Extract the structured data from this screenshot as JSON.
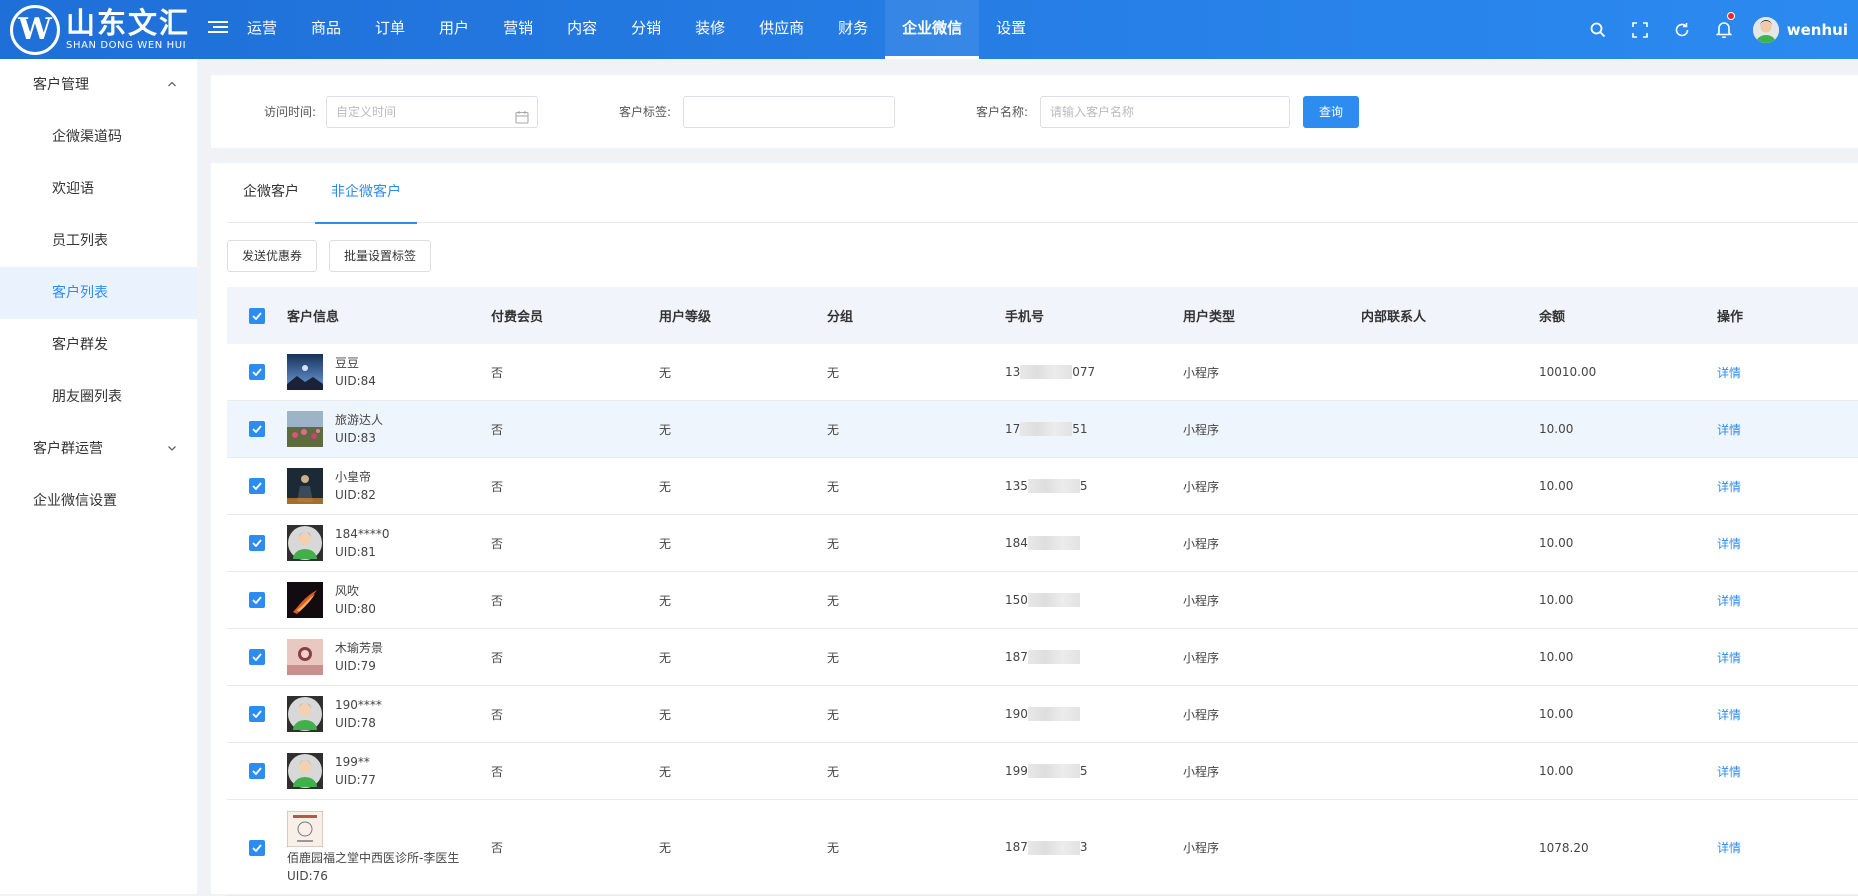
{
  "brand": {
    "name_cn": "山东文汇",
    "name_en": "SHAN DONG WEN HUI",
    "logo_letter": "W"
  },
  "nav": {
    "items": [
      "运营",
      "商品",
      "订单",
      "用户",
      "营销",
      "内容",
      "分销",
      "装修",
      "供应商",
      "财务",
      "企业微信",
      "设置"
    ],
    "active": "企业微信"
  },
  "user": {
    "name": "wenhui"
  },
  "sidebar": {
    "groups": [
      {
        "label": "客户管理",
        "expanded": true,
        "items": [
          "企微渠道码",
          "欢迎语",
          "员工列表",
          "客户列表",
          "客户群发",
          "朋友圈列表"
        ],
        "active": "客户列表"
      },
      {
        "label": "客户群运营",
        "expanded": false
      },
      {
        "label": "企业微信设置"
      }
    ]
  },
  "filters": {
    "visit_time_label": "访问时间:",
    "visit_time_placeholder": "自定义时间",
    "tag_label": "客户标签:",
    "tag_value": "",
    "name_label": "客户名称:",
    "name_placeholder": "请输入客户名称",
    "query_label": "查询"
  },
  "tabs": {
    "items": [
      "企微客户",
      "非企微客户"
    ],
    "active": "非企微客户"
  },
  "actions": {
    "send_coupon": "发送优惠券",
    "batch_tag": "批量设置标签"
  },
  "table": {
    "columns": [
      "客户信息",
      "付费会员",
      "用户等级",
      "分组",
      "手机号",
      "用户类型",
      "内部联系人",
      "余额",
      "操作"
    ],
    "rows": [
      {
        "name": "豆豆",
        "uid": "UID:84",
        "vip": "否",
        "level": "无",
        "group": "无",
        "phone_prefix": "13",
        "phone_suffix": "077",
        "type": "小程序",
        "contact": "",
        "balance": "10010.00",
        "op": "详情",
        "avatar": "night-sky"
      },
      {
        "name": "旅游达人",
        "uid": "UID:83",
        "vip": "否",
        "level": "无",
        "group": "无",
        "phone_prefix": "17",
        "phone_suffix": "51",
        "type": "小程序",
        "contact": "",
        "balance": "10.00",
        "op": "详情",
        "avatar": "flowers"
      },
      {
        "name": "小皇帝",
        "uid": "UID:82",
        "vip": "否",
        "level": "无",
        "group": "无",
        "phone_prefix": "135",
        "phone_suffix": "5",
        "type": "小程序",
        "contact": "",
        "balance": "10.00",
        "op": "详情",
        "avatar": "dark-figure"
      },
      {
        "name": "184****0",
        "uid": "UID:81",
        "vip": "否",
        "level": "无",
        "group": "无",
        "phone_prefix": "184",
        "phone_suffix": "",
        "type": "小程序",
        "contact": "",
        "balance": "10.00",
        "op": "详情",
        "avatar": "default"
      },
      {
        "name": "风吹",
        "uid": "UID:80",
        "vip": "否",
        "level": "无",
        "group": "无",
        "phone_prefix": "150",
        "phone_suffix": "",
        "type": "小程序",
        "contact": "",
        "balance": "10.00",
        "op": "详情",
        "avatar": "flame"
      },
      {
        "name": "木瑜芳景",
        "uid": "UID:79",
        "vip": "否",
        "level": "无",
        "group": "无",
        "phone_prefix": "187",
        "phone_suffix": "",
        "type": "小程序",
        "contact": "",
        "balance": "10.00",
        "op": "详情",
        "avatar": "pink"
      },
      {
        "name": "190****",
        "uid": "UID:78",
        "vip": "否",
        "level": "无",
        "group": "无",
        "phone_prefix": "190",
        "phone_suffix": "",
        "type": "小程序",
        "contact": "",
        "balance": "10.00",
        "op": "详情",
        "avatar": "default"
      },
      {
        "name": "199**",
        "uid": "UID:77",
        "vip": "否",
        "level": "无",
        "group": "无",
        "phone_prefix": "199",
        "phone_suffix": "5",
        "type": "小程序",
        "contact": "",
        "balance": "10.00",
        "op": "详情",
        "avatar": "default"
      },
      {
        "name": "佰鹿园福之堂中西医诊所-李医生",
        "uid": "UID:76",
        "vip": "否",
        "level": "无",
        "group": "无",
        "phone_prefix": "187",
        "phone_suffix": "3",
        "type": "小程序",
        "contact": "",
        "balance": "1078.20",
        "op": "详情",
        "avatar": "clinic"
      }
    ]
  },
  "colors": {
    "primary": "#2d8cf0",
    "topbar_start": "#1f6fd8",
    "topbar_end": "#2b8af0",
    "selected_row": "#eef5fd"
  }
}
